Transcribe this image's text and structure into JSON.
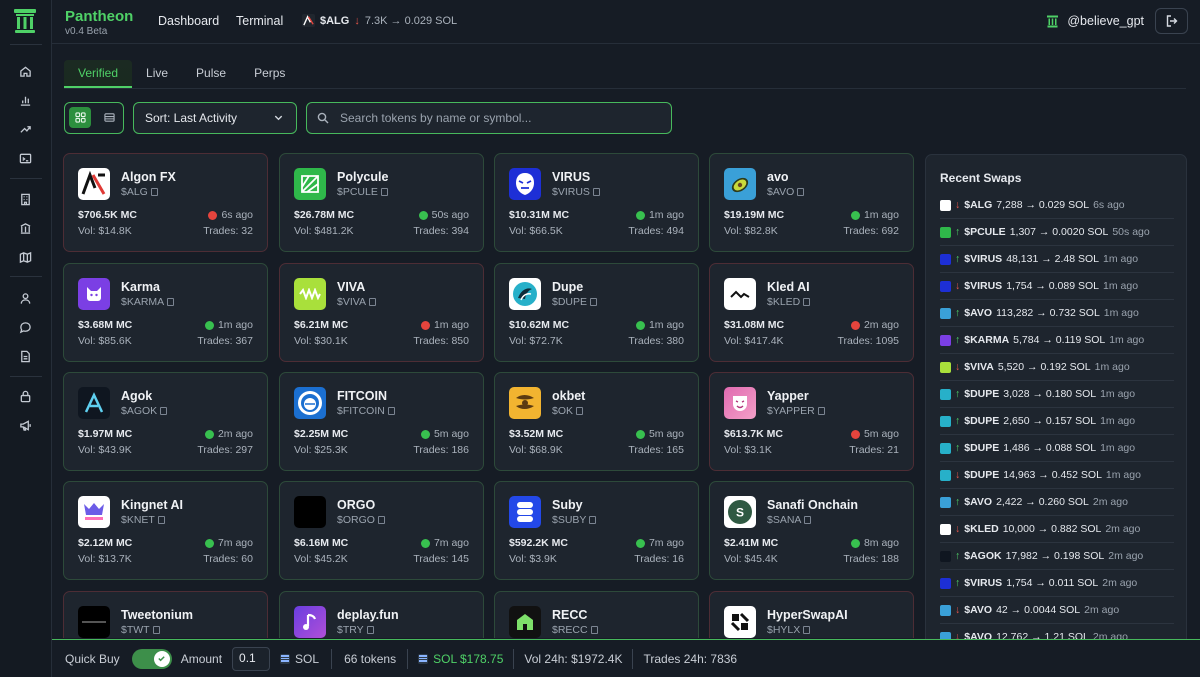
{
  "app": {
    "name": "Pantheon",
    "version": "v0.4 Beta"
  },
  "nav": {
    "dashboard": "Dashboard",
    "terminal": "Terminal"
  },
  "ticker": {
    "symbol": "$ALG",
    "direction": "down",
    "amount": "7.3K → 0.029 SOL"
  },
  "user": {
    "handle": "@believe_gpt"
  },
  "tabs": [
    "Verified",
    "Live",
    "Pulse",
    "Perps"
  ],
  "active_tab": "Verified",
  "controls": {
    "sort_label": "Sort: Last Activity",
    "search_placeholder": "Search tokens by name or symbol..."
  },
  "colors": {
    "accent": "#4fd167",
    "up": "#38c04f",
    "down": "#e5443d"
  },
  "tokens": [
    {
      "name": "Algon FX",
      "symbol": "$ALG",
      "mc": "$706.5K MC",
      "ago": "6s ago",
      "status": "red",
      "vol": "Vol: $14.8K",
      "trades": "Trades: 32"
    },
    {
      "name": "Polycule",
      "symbol": "$PCULE",
      "mc": "$26.78M MC",
      "ago": "50s ago",
      "status": "green",
      "vol": "Vol: $481.2K",
      "trades": "Trades: 394"
    },
    {
      "name": "VIRUS",
      "symbol": "$VIRUS",
      "mc": "$10.31M MC",
      "ago": "1m ago",
      "status": "green",
      "vol": "Vol: $66.5K",
      "trades": "Trades: 494"
    },
    {
      "name": "avo",
      "symbol": "$AVO",
      "mc": "$19.19M MC",
      "ago": "1m ago",
      "status": "green",
      "vol": "Vol: $82.8K",
      "trades": "Trades: 692"
    },
    {
      "name": "Karma",
      "symbol": "$KARMA",
      "mc": "$3.68M MC",
      "ago": "1m ago",
      "status": "green",
      "vol": "Vol: $85.6K",
      "trades": "Trades: 367"
    },
    {
      "name": "VIVA",
      "symbol": "$VIVA",
      "mc": "$6.21M MC",
      "ago": "1m ago",
      "status": "red",
      "vol": "Vol: $30.1K",
      "trades": "Trades: 850"
    },
    {
      "name": "Dupe",
      "symbol": "$DUPE",
      "mc": "$10.62M MC",
      "ago": "1m ago",
      "status": "green",
      "vol": "Vol: $72.7K",
      "trades": "Trades: 380"
    },
    {
      "name": "Kled AI",
      "symbol": "$KLED",
      "mc": "$31.08M MC",
      "ago": "2m ago",
      "status": "red",
      "vol": "Vol: $417.4K",
      "trades": "Trades: 1095"
    },
    {
      "name": "Agok",
      "symbol": "$AGOK",
      "mc": "$1.97M MC",
      "ago": "2m ago",
      "status": "green",
      "vol": "Vol: $43.9K",
      "trades": "Trades: 297"
    },
    {
      "name": "FITCOIN",
      "symbol": "$FITCOIN",
      "mc": "$2.25M MC",
      "ago": "5m ago",
      "status": "green",
      "vol": "Vol: $25.3K",
      "trades": "Trades: 186"
    },
    {
      "name": "okbet",
      "symbol": "$OK",
      "mc": "$3.52M MC",
      "ago": "5m ago",
      "status": "green",
      "vol": "Vol: $68.9K",
      "trades": "Trades: 165"
    },
    {
      "name": "Yapper",
      "symbol": "$YAPPER",
      "mc": "$613.7K MC",
      "ago": "5m ago",
      "status": "red",
      "vol": "Vol: $3.1K",
      "trades": "Trades: 21"
    },
    {
      "name": "Kingnet AI",
      "symbol": "$KNET",
      "mc": "$2.12M MC",
      "ago": "7m ago",
      "status": "green",
      "vol": "Vol: $13.7K",
      "trades": "Trades: 60"
    },
    {
      "name": "ORGO",
      "symbol": "$ORGO",
      "mc": "$6.16M MC",
      "ago": "7m ago",
      "status": "green",
      "vol": "Vol: $45.2K",
      "trades": "Trades: 145"
    },
    {
      "name": "Suby",
      "symbol": "$SUBY",
      "mc": "$592.2K MC",
      "ago": "7m ago",
      "status": "green",
      "vol": "Vol: $3.9K",
      "trades": "Trades: 16"
    },
    {
      "name": "Sanafi Onchain",
      "symbol": "$SANA",
      "mc": "$2.41M MC",
      "ago": "8m ago",
      "status": "green",
      "vol": "Vol: $45.4K",
      "trades": "Trades: 188"
    },
    {
      "name": "Tweetonium",
      "symbol": "$TWT"
    },
    {
      "name": "deplay.fun",
      "symbol": "$TRY"
    },
    {
      "name": "RECC",
      "symbol": "$RECC"
    },
    {
      "name": "HyperSwapAI",
      "symbol": "$HYLX"
    }
  ],
  "recent_swaps": {
    "title": "Recent Swaps",
    "items": [
      {
        "dir": "down",
        "symbol": "$ALG",
        "amount": "7,288 → 0.029 SOL",
        "ago": "6s ago"
      },
      {
        "dir": "up",
        "symbol": "$PCULE",
        "amount": "1,307 → 0.0020 SOL",
        "ago": "50s ago"
      },
      {
        "dir": "up",
        "symbol": "$VIRUS",
        "amount": "48,131 → 2.48 SOL",
        "ago": "1m ago"
      },
      {
        "dir": "down",
        "symbol": "$VIRUS",
        "amount": "1,754 → 0.089 SOL",
        "ago": "1m ago"
      },
      {
        "dir": "up",
        "symbol": "$AVO",
        "amount": "113,282 → 0.732 SOL",
        "ago": "1m ago"
      },
      {
        "dir": "up",
        "symbol": "$KARMA",
        "amount": "5,784 → 0.119 SOL",
        "ago": "1m ago"
      },
      {
        "dir": "down",
        "symbol": "$VIVA",
        "amount": "5,520 → 0.192 SOL",
        "ago": "1m ago"
      },
      {
        "dir": "up",
        "symbol": "$DUPE",
        "amount": "3,028 → 0.180 SOL",
        "ago": "1m ago"
      },
      {
        "dir": "up",
        "symbol": "$DUPE",
        "amount": "2,650 → 0.157 SOL",
        "ago": "1m ago"
      },
      {
        "dir": "up",
        "symbol": "$DUPE",
        "amount": "1,486 → 0.088 SOL",
        "ago": "1m ago"
      },
      {
        "dir": "down",
        "symbol": "$DUPE",
        "amount": "14,963 → 0.452 SOL",
        "ago": "1m ago"
      },
      {
        "dir": "up",
        "symbol": "$AVO",
        "amount": "2,422 → 0.260 SOL",
        "ago": "2m ago"
      },
      {
        "dir": "down",
        "symbol": "$KLED",
        "amount": "10,000 → 0.882 SOL",
        "ago": "2m ago"
      },
      {
        "dir": "up",
        "symbol": "$AGOK",
        "amount": "17,982 → 0.198 SOL",
        "ago": "2m ago"
      },
      {
        "dir": "up",
        "symbol": "$VIRUS",
        "amount": "1,754 → 0.011 SOL",
        "ago": "2m ago"
      },
      {
        "dir": "down",
        "symbol": "$AVO",
        "amount": "42 → 0.0044 SOL",
        "ago": "2m ago"
      },
      {
        "dir": "down",
        "symbol": "$AVO",
        "amount": "12,762 → 1.21 SOL",
        "ago": "2m ago"
      }
    ]
  },
  "bottom": {
    "quick_buy": "Quick Buy",
    "amount_label": "Amount",
    "amount_value": "0.1",
    "currency": "SOL",
    "token_count": "66 tokens",
    "sol_price": "SOL $178.75",
    "vol24h": "Vol 24h: $1972.4K",
    "trades24h": "Trades 24h: 7836"
  }
}
